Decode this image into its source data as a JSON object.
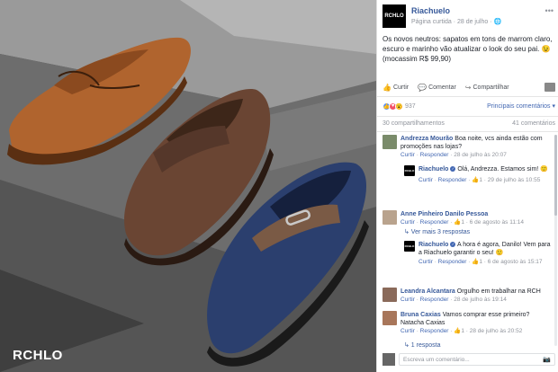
{
  "photo": {
    "watermark": "RCHLO"
  },
  "post": {
    "avatar_text": "RCHLO",
    "page_name": "Riachuelo",
    "meta": "Página curtida · 28 de julho · ",
    "globe_icon": "globe-icon",
    "text": "Os novos neutros: sapatos em tons de marrom claro, escuro e marinho vão atualizar o look do seu pai. 😉 (mocassim R$ 99,90)"
  },
  "actions": {
    "like": "Curtir",
    "comment": "Comentar",
    "share": "Compartilhar"
  },
  "reactions": {
    "count": "937",
    "relevance": "Principais comentários ▾"
  },
  "counts": {
    "shares": "30 compartilhamentos",
    "comments": "41 comentários"
  },
  "comments": [
    {
      "name": "Andrezza Mourão",
      "text": " Boa noite, vcs ainda estão com promoções nas lojas?",
      "meta_like": "Curtir",
      "meta_reply": "Responder",
      "meta_time": "28 de julho às 20:07"
    },
    {
      "name": "Riachuelo",
      "avatar_text": "RCHLO",
      "text": " Olá, Andrezza. Estamos sim! 🙂",
      "meta_like": "Curtir",
      "meta_reply": "Responder",
      "likes": "1",
      "meta_time": "29 de julho às 10:55"
    },
    {
      "name": "Anne Pinheiro",
      "text": " Danilo Pessoa",
      "meta_like": "Curtir",
      "meta_reply": "Responder",
      "likes": "1",
      "meta_time": "6 de agosto às 11:14"
    },
    {
      "see_more": "↳ Ver mais 3 respostas"
    },
    {
      "name": "Riachuelo",
      "avatar_text": "RCHLO",
      "text": " A hora é agora, Danilo! Vem para a Riachuelo garantir o seu! 🙂",
      "meta_like": "Curtir",
      "meta_reply": "Responder",
      "likes": "1",
      "meta_time": "6 de agosto às 15:17"
    },
    {
      "name": "Leandra Alcantara",
      "text": " Orgulho em trabalhar na RCH",
      "meta_like": "Curtir",
      "meta_reply": "Responder",
      "meta_time": "28 de julho às 19:14"
    },
    {
      "name": "Bruna Caxias",
      "text": " Vamos comprar esse primeiro? Natacha Caxias",
      "meta_like": "Curtir",
      "meta_reply": "Responder",
      "likes": "1",
      "meta_time": "28 de julho às 20:52"
    },
    {
      "see_more": "↳ 1 resposta"
    }
  ],
  "write": {
    "placeholder": "Escreva um comentário..."
  }
}
